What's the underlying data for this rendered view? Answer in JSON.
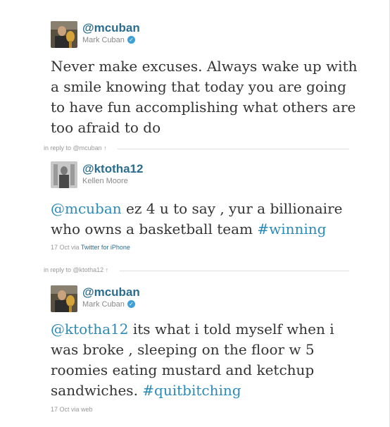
{
  "tweets": [
    {
      "handle": "@mcuban",
      "name": "Mark Cuban",
      "verified": true,
      "lines": [
        "Never make excuses. Always wake up with",
        "a smile knowing that today you are going",
        "to have fun accomplishing what others are",
        "too afraid to do"
      ]
    },
    {
      "reply_to": "in reply to @mcuban ↑",
      "handle": "@ktotha12",
      "name": "Kellen Moore",
      "mention": "@mcuban",
      "line1_rest": " ez 4 u to say , yur a billionaire",
      "line2_pre": "who owns a basketball team ",
      "hashtag": "#winning",
      "date": "17 Oct",
      "via": " via ",
      "source": "Twitter for iPhone"
    },
    {
      "reply_to": "in reply to @ktotha12 ↑",
      "handle": "@mcuban",
      "name": "Mark Cuban",
      "verified": true,
      "mention": "@ktotha12",
      "line1_rest": " its what i told myself when i",
      "line2": "was broke , sleeping on the floor w 5",
      "line3": "roomies eating mustard and ketchup",
      "line4_pre": "sandwiches. ",
      "hashtag": "#quitbitching",
      "date": "17 Oct",
      "via_source": " via web"
    }
  ],
  "icons": {
    "verified": "verified-check-icon",
    "reply_arrow": "up-arrow-icon"
  },
  "colors": {
    "handle": "#2a6d8f",
    "link": "#2a8ab9",
    "verified": "#3ea0d6",
    "meta": "#999999",
    "body_text": "#333333"
  }
}
